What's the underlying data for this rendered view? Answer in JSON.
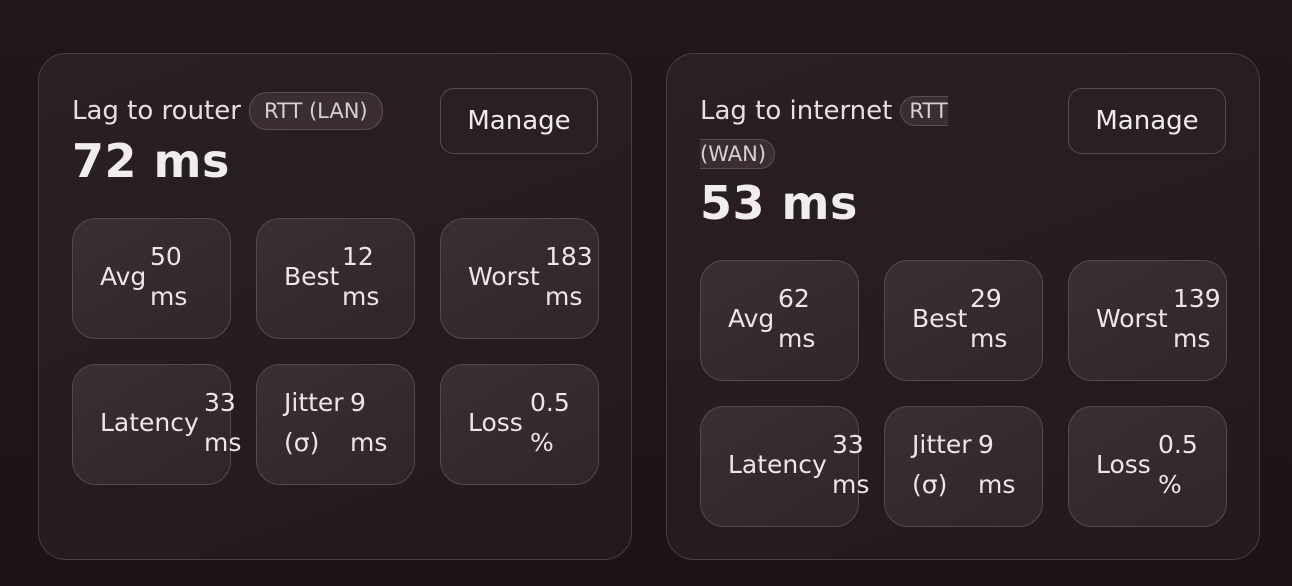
{
  "panels": [
    {
      "title": "Lag to router",
      "chip": "RTT (LAN)",
      "value": "72 ms",
      "manage_label": "Manage",
      "stats": {
        "avg": {
          "label": "Avg",
          "value": "50",
          "unit": "ms"
        },
        "best": {
          "label": "Best",
          "value": "12",
          "unit": "ms"
        },
        "worst": {
          "label": "Worst",
          "value": "183",
          "unit": "ms"
        },
        "latency": {
          "label": "Latency",
          "value": "33",
          "unit": "ms"
        },
        "jitter": {
          "label": "Jitter",
          "label2": "(σ)",
          "value": "9",
          "unit": "ms"
        },
        "loss": {
          "label": "Loss",
          "value": "0.5",
          "unit": "%"
        }
      }
    },
    {
      "title": "Lag to internet",
      "chip": "RTT (WAN)",
      "value": "53 ms",
      "manage_label": "Manage",
      "stats": {
        "avg": {
          "label": "Avg",
          "value": "62",
          "unit": "ms"
        },
        "best": {
          "label": "Best",
          "value": "29",
          "unit": "ms"
        },
        "worst": {
          "label": "Worst",
          "value": "139",
          "unit": "ms"
        },
        "latency": {
          "label": "Latency",
          "value": "33",
          "unit": "ms"
        },
        "jitter": {
          "label": "Jitter",
          "label2": "(σ)",
          "value": "9",
          "unit": "ms"
        },
        "loss": {
          "label": "Loss",
          "value": "0.5",
          "unit": "%"
        }
      }
    }
  ]
}
